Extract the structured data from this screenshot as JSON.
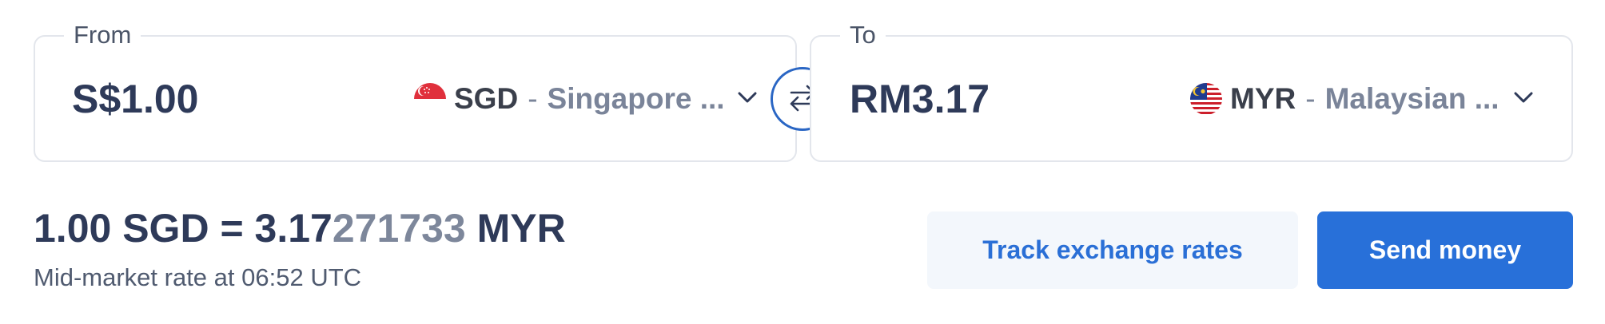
{
  "from": {
    "legend": "From",
    "amount": "S$1.00",
    "currency_code": "SGD",
    "separator": "-",
    "currency_name": "Singapore ...",
    "flag_icon": "singapore-flag-icon"
  },
  "to": {
    "legend": "To",
    "amount": "RM3.17",
    "currency_code": "MYR",
    "separator": "-",
    "currency_name": "Malaysian ...",
    "flag_icon": "malaysia-flag-icon"
  },
  "swap_icon": "swap-arrows-icon",
  "rate": {
    "lhs": "1.00 SGD = 3.17",
    "dim_digits": "271733",
    "rhs": " MYR",
    "subtitle": "Mid-market rate at 06:52 UTC"
  },
  "buttons": {
    "track": "Track exchange rates",
    "send": "Send money"
  },
  "colors": {
    "accent": "#2870d9",
    "swap_border": "#2a66c4",
    "track_bg": "#f3f7fc",
    "text_dark": "#2e3a59",
    "text_muted": "#7d879b"
  }
}
